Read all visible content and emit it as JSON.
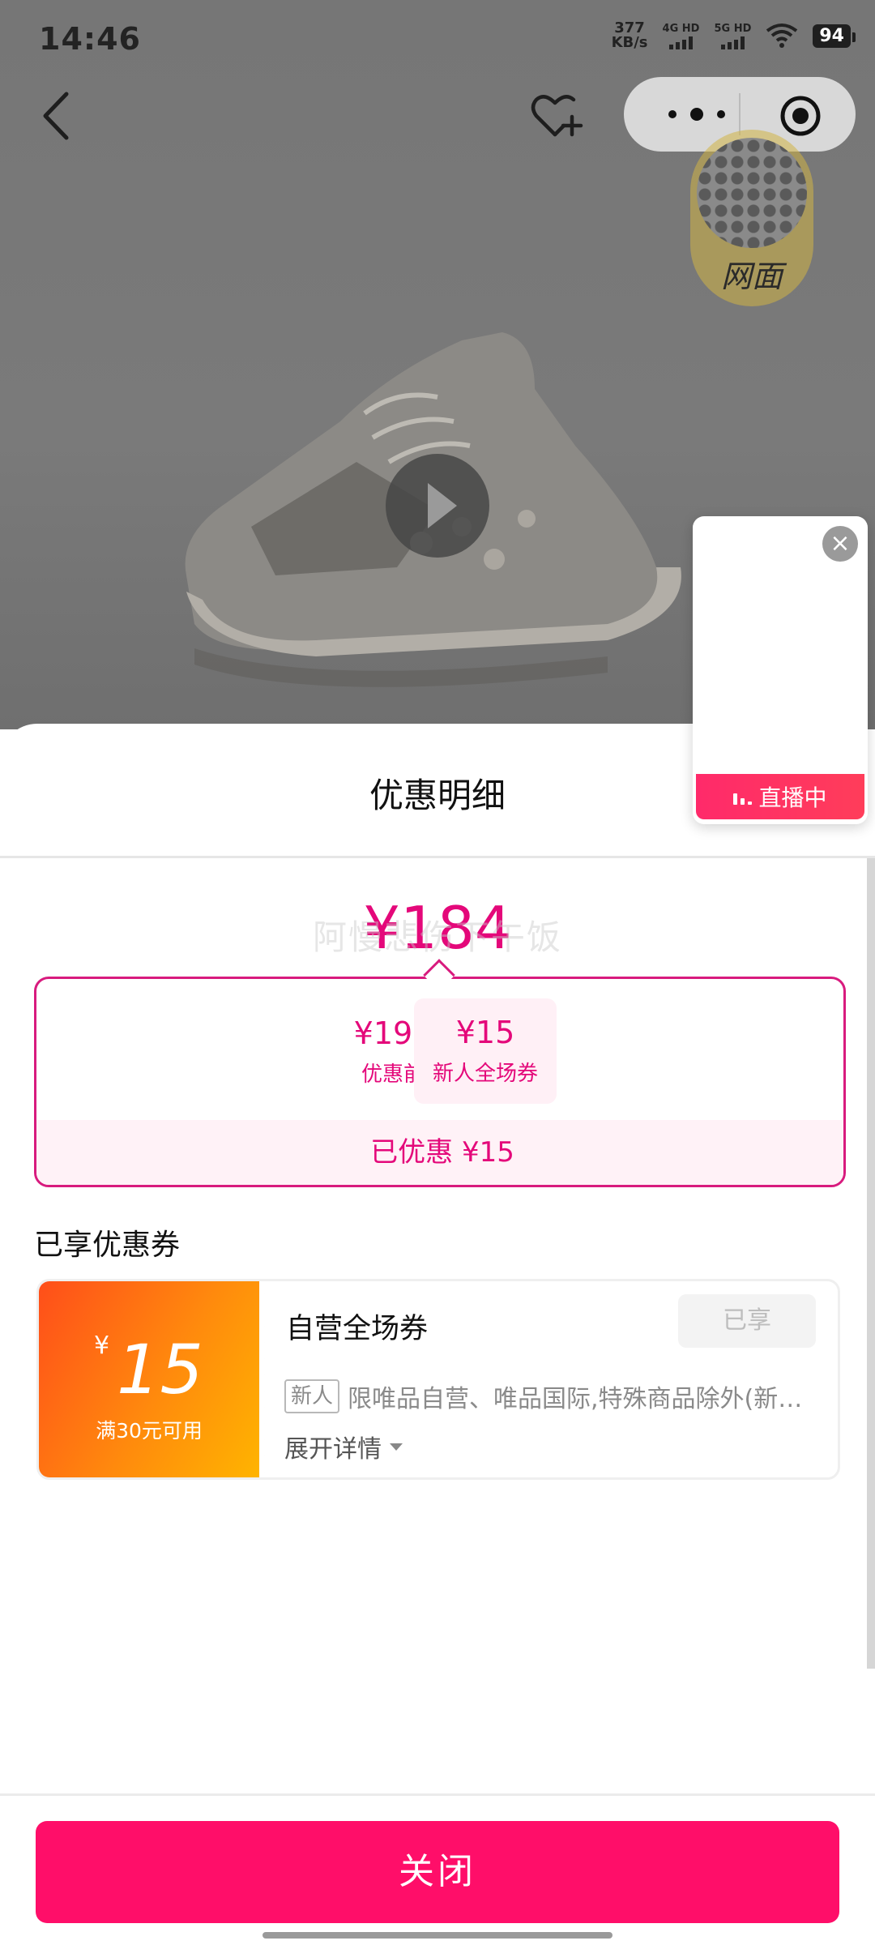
{
  "status_bar": {
    "time": "14:46",
    "net_speed_value": "377",
    "net_speed_unit": "KB/s",
    "signal_1": "4G HD",
    "signal_2": "5G HD",
    "battery": "94"
  },
  "product": {
    "material_badge": "网面"
  },
  "live_widget": {
    "label": "直播中"
  },
  "sheet": {
    "title": "优惠明细",
    "final_price": "¥184",
    "watermark": "阿慢悲伤下午饭",
    "breakdown": {
      "original_price": "¥199",
      "original_label": "优惠前",
      "coupon_value": "¥15",
      "coupon_label": "新人全场券",
      "saved_text": "已优惠 ¥15"
    },
    "coupons_section_title": "已享优惠券",
    "coupon": {
      "currency": "¥",
      "amount": "15",
      "condition": "满30元可用",
      "name": "自营全场券",
      "status": "已享",
      "tag": "新人",
      "description": "限唯品自营、唯品国际,特殊商品除外(新…",
      "expand_label": "展开详情"
    },
    "close_button": "关闭"
  },
  "colors": {
    "accent_pink": "#e4087a",
    "button_pink": "#ff0e69",
    "coupon_orange": "#ff8a0d"
  }
}
